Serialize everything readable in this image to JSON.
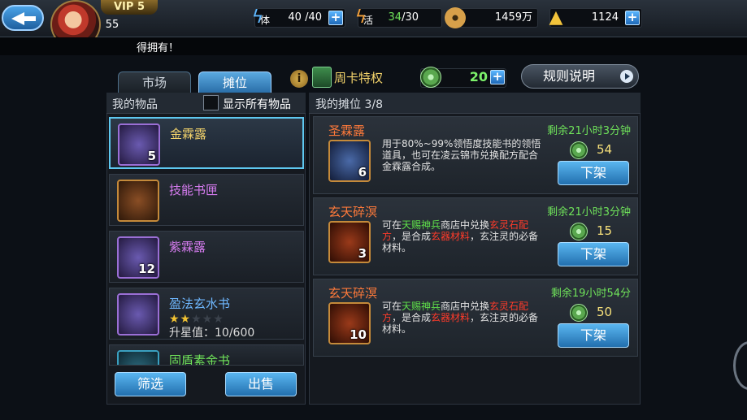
{
  "header": {
    "vip": "VIP 5",
    "level": "55",
    "stamina_label": "体",
    "stamina": "40 /40",
    "vitality_label": "活",
    "vitality_current": "34",
    "vitality_max": "/30",
    "copper": "1459万",
    "gold": "1124"
  },
  "notice": "得拥有！",
  "tabs": [
    "市场",
    "摊位"
  ],
  "weekly_card": "周卡特权",
  "coin_balance": "20",
  "rules_label": "规则说明",
  "left": {
    "header": "我的物品",
    "show_all": "显示所有物品",
    "items": [
      {
        "name": "金霖露",
        "count": "5",
        "color": "#f3d36b"
      },
      {
        "name": "技能书匣",
        "count": "",
        "color": "#d67cf0"
      },
      {
        "name": "紫霖露",
        "count": "12",
        "color": "#d67cf0"
      },
      {
        "name": "盈法玄水书",
        "count": "",
        "color": "#6fb8ff",
        "stars_on": 2,
        "stars_total": 5,
        "sub": "升星值：10/600"
      },
      {
        "name": "固盾素金书",
        "count": "",
        "color": "#6fe25a"
      }
    ],
    "filter": "筛选",
    "sell": "出售"
  },
  "right": {
    "header": "我的摊位 3/8",
    "listings": [
      {
        "name": "圣霖露",
        "count": "6",
        "desc": "用于80%~99%领悟度技能书的领悟道具，也可在凌云锦市兑换配方配合金霖露合成。",
        "time": "剩余21小时3分钟",
        "price": "54",
        "action": "下架"
      },
      {
        "name": "玄天碎溟",
        "count": "3",
        "desc_a": "可在",
        "desc_b": "天赐神兵",
        "desc_c": "商店中兑换",
        "desc_d": "玄灵石配方",
        "desc_e": "，是合成",
        "desc_f": "玄器材料",
        "desc_g": "，玄注灵的必备材料。",
        "time": "剩余21小时3分钟",
        "price": "15",
        "action": "下架"
      },
      {
        "name": "玄天碎溟",
        "count": "10",
        "desc_a": "可在",
        "desc_b": "天赐神兵",
        "desc_c": "商店中兑换",
        "desc_d": "玄灵石配方",
        "desc_e": "，是合成",
        "desc_f": "玄器材料",
        "desc_g": "，玄注灵的必备材料。",
        "time": "剩余19小时54分",
        "price": "50",
        "action": "下架"
      }
    ]
  }
}
